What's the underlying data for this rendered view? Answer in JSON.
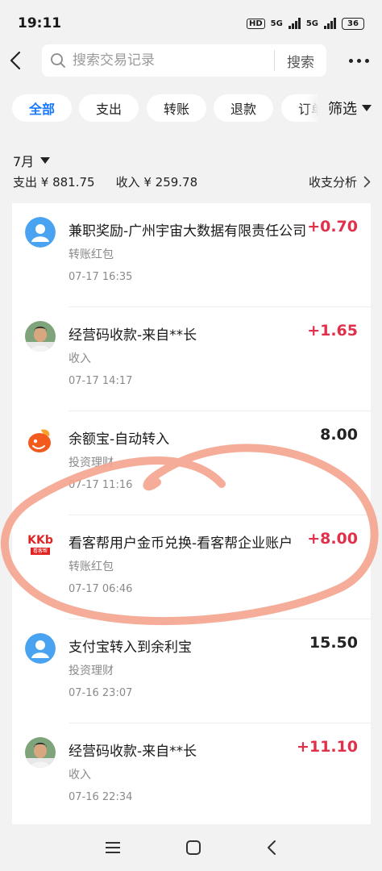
{
  "status_bar": {
    "time": "19:11",
    "hd_label": "HD",
    "network_1": "5G",
    "network_2": "5G",
    "battery": "36"
  },
  "search": {
    "placeholder": "搜索交易记录",
    "button_label": "搜索"
  },
  "tabs": [
    {
      "label": "全部",
      "active": true
    },
    {
      "label": "支出",
      "active": false
    },
    {
      "label": "转账",
      "active": false
    },
    {
      "label": "退款",
      "active": false
    },
    {
      "label": "订单",
      "active": false
    }
  ],
  "filter_label": "筛选",
  "month": {
    "label": "7月",
    "expense": "支出 ¥ 881.75",
    "income": "收入 ¥ 259.78",
    "analysis_label": "收支分析"
  },
  "transactions": [
    {
      "title": "兼职奖励-广州宇宙大数据有限责任公司",
      "amount": "+0.70",
      "category": "转账红包",
      "time": "07-17 16:35",
      "icon": "default-user-icon",
      "positive": true
    },
    {
      "title": "经营码收款-来自**长",
      "amount": "+1.65",
      "category": "收入",
      "time": "07-17 14:17",
      "icon": "user-photo-avatar",
      "positive": true
    },
    {
      "title": "余额宝-自动转入",
      "amount": "8.00",
      "category": "投资理财",
      "time": "07-17 11:16",
      "icon": "yuebao-icon",
      "positive": false
    },
    {
      "title": "看客帮用户金币兑换-看客帮企业账户",
      "amount": "+8.00",
      "category": "转账红包",
      "time": "07-17 06:46",
      "icon": "kkb-logo",
      "positive": true
    },
    {
      "title": "支付宝转入到余利宝",
      "amount": "15.50",
      "category": "投资理财",
      "time": "07-16 23:07",
      "icon": "default-user-icon",
      "positive": false
    },
    {
      "title": "经营码收款-来自**长",
      "amount": "+11.10",
      "category": "收入",
      "time": "07-16 22:34",
      "icon": "user-photo-avatar",
      "positive": true
    }
  ],
  "kkb_logo_text": "KKb",
  "kkb_logo_sub": "看客帮",
  "colors": {
    "accent": "#1677ff",
    "positive_amount": "#e0304a",
    "scribble": "#f4a48e"
  }
}
